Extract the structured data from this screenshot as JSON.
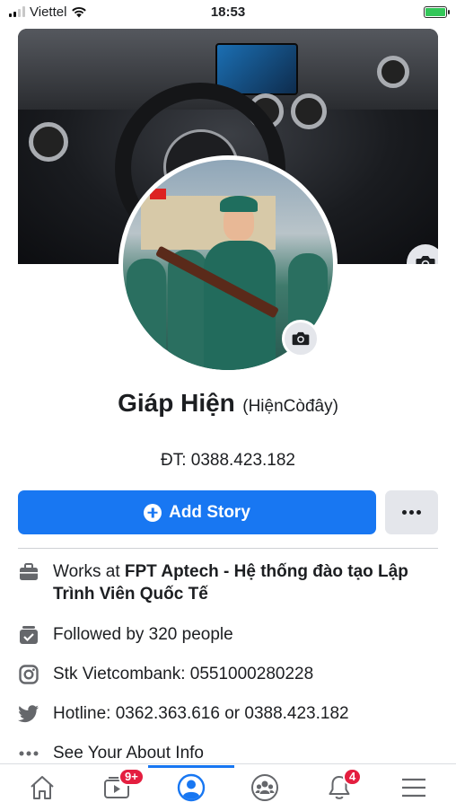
{
  "status_bar": {
    "carrier": "Viettel",
    "time": "18:53"
  },
  "profile": {
    "name": "Giáp Hiện",
    "alternate_name": "(HiệnCòđây)",
    "bio": "ĐT: 0388.423.182"
  },
  "actions": {
    "add_story_label": "Add Story",
    "more_label": "..."
  },
  "details": {
    "work_prefix": "Works at ",
    "work_place": "FPT Aptech - Hệ thống đào tạo Lập Trình Viên Quốc Tế",
    "followers": "Followed by 320 people",
    "instagram": "Stk Vietcombank: 0551000280228",
    "twitter": "Hotline: 0362.363.616 or 0388.423.182",
    "about_link": "See Your About Info"
  },
  "nav": {
    "watch_badge": "9+",
    "notifications_badge": "4",
    "active_tab": "profile"
  },
  "colors": {
    "accent": "#1877f2",
    "badge": "#e41e3f",
    "battery": "#33c759"
  },
  "icons": [
    "signal-icon",
    "wifi-icon",
    "battery-icon",
    "camera-icon",
    "plus-circle-icon",
    "more-icon",
    "briefcase-icon",
    "followers-icon",
    "instagram-icon",
    "twitter-icon",
    "ellipsis-icon",
    "home-icon",
    "watch-icon",
    "profile-icon",
    "groups-icon",
    "bell-icon",
    "menu-icon"
  ]
}
